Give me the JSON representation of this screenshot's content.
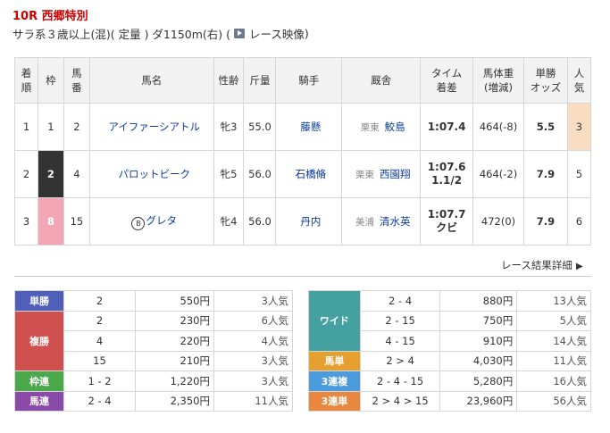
{
  "race": {
    "number": "10R",
    "name": "西郷特別",
    "conditions": "サラ系３歳以上(混)( 定量 ) ダ1150m(右)  (",
    "video_label": "レース映像",
    "video_close": " )"
  },
  "table": {
    "headers": {
      "rank": [
        "着",
        "順"
      ],
      "waku": "枠",
      "umaban": [
        "馬",
        "番"
      ],
      "horse": "馬名",
      "sexage": "性齢",
      "weight": "斤量",
      "jockey": "騎手",
      "trainer": "厩舎",
      "time": [
        "タイム",
        "着差"
      ],
      "body": [
        "馬体重",
        "(増減)"
      ],
      "odds": [
        "単勝",
        "オッズ"
      ],
      "pop": [
        "人",
        "気"
      ]
    },
    "rows": [
      {
        "rank": "1",
        "waku": "1",
        "umaban": "2",
        "blinker": "",
        "horse": "アイファーシアトル",
        "sexage": "牝3",
        "weight": "55.0",
        "jockey": "藤懸",
        "region": "栗東",
        "trainer": "鮫島",
        "time": "1:07.4",
        "margin": "",
        "body": "464(-8)",
        "odds": "5.5",
        "pop": "3"
      },
      {
        "rank": "2",
        "waku": "2",
        "umaban": "4",
        "blinker": "",
        "horse": "パロットビーク",
        "sexage": "牝5",
        "weight": "56.0",
        "jockey": "石橋脩",
        "region": "栗東",
        "trainer": "西園翔",
        "time": "1:07.6",
        "margin": "1.1/2",
        "body": "464(-2)",
        "odds": "7.9",
        "pop": "5"
      },
      {
        "rank": "3",
        "waku": "8",
        "umaban": "15",
        "blinker": "B",
        "horse": "グレタ",
        "sexage": "牝4",
        "weight": "56.0",
        "jockey": "丹内",
        "region": "美浦",
        "trainer": "清水英",
        "time": "1:07.7",
        "margin": "クビ",
        "body": "472(0)",
        "odds": "7.9",
        "pop": "6"
      }
    ]
  },
  "more_link": "レース結果詳細",
  "payouts_left": [
    {
      "label": "単勝",
      "entries": [
        {
          "num": "2",
          "amount": "550円",
          "pop": "3人気"
        }
      ]
    },
    {
      "label": "複勝",
      "entries": [
        {
          "num": "2",
          "amount": "230円",
          "pop": "6人気"
        },
        {
          "num": "4",
          "amount": "220円",
          "pop": "4人気"
        },
        {
          "num": "15",
          "amount": "210円",
          "pop": "3人気"
        }
      ]
    },
    {
      "label": "枠連",
      "entries": [
        {
          "num": "1 - 2",
          "amount": "1,220円",
          "pop": "3人気"
        }
      ]
    },
    {
      "label": "馬連",
      "entries": [
        {
          "num": "2 - 4",
          "amount": "2,350円",
          "pop": "11人気"
        }
      ]
    }
  ],
  "payouts_right": [
    {
      "label": "ワイド",
      "entries": [
        {
          "num": "2 - 4",
          "amount": "880円",
          "pop": "13人気"
        },
        {
          "num": "2 - 15",
          "amount": "750円",
          "pop": "5人気"
        },
        {
          "num": "4 - 15",
          "amount": "910円",
          "pop": "14人気"
        }
      ]
    },
    {
      "label": "馬単",
      "entries": [
        {
          "num": "2 > 4",
          "amount": "4,030円",
          "pop": "11人気"
        }
      ]
    },
    {
      "label": "3連複",
      "entries": [
        {
          "num": "2 - 4 - 15",
          "amount": "5,280円",
          "pop": "16人気"
        }
      ]
    },
    {
      "label": "3連単",
      "entries": [
        {
          "num": "2 > 4 > 15",
          "amount": "23,960円",
          "pop": "56人気"
        }
      ]
    }
  ],
  "colors": {
    "tansho": "#5060b8",
    "fukusho": "#d05050",
    "wakuren": "#4aa84a",
    "umaren": "#8a4aa8",
    "wide": "#45a0a0",
    "umatan": "#e6a030",
    "sanrenpuku": "#4a9adc",
    "sanrentan": "#e88840",
    "waku1": "#ffffff",
    "waku2": "#333333",
    "waku8": "#f3a6b6"
  }
}
